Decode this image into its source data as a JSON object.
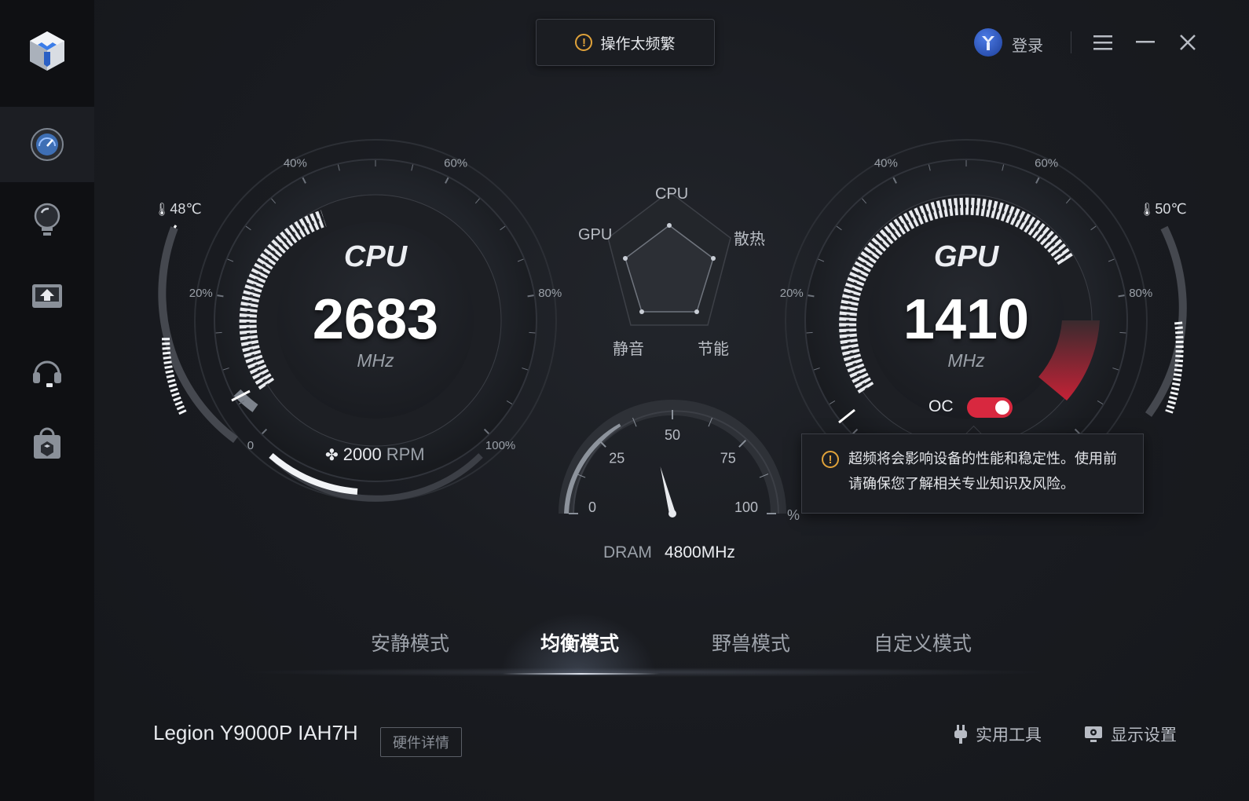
{
  "toast": {
    "text": "操作太频繁"
  },
  "header": {
    "login_label": "登录"
  },
  "cpu_gauge": {
    "title": "CPU",
    "value": "2683",
    "unit": "MHz",
    "temp": "48℃",
    "fan_value": "2000",
    "fan_unit": "RPM",
    "ticks": [
      "0",
      "20%",
      "40%",
      "60%",
      "80%",
      "100%"
    ],
    "load_fraction": 0.08
  },
  "gpu_gauge": {
    "title": "GPU",
    "value": "1410",
    "unit": "MHz",
    "temp": "50℃",
    "ticks": [
      "20%",
      "40%",
      "60%",
      "80%"
    ],
    "oc_label": "OC",
    "oc_enabled": true
  },
  "radar": {
    "labels": {
      "top": "CPU",
      "left": "GPU",
      "right": "散热",
      "bottom_left": "静音",
      "bottom_right": "节能"
    }
  },
  "dram_gauge": {
    "ticks": [
      "0",
      "25",
      "50",
      "75",
      "100"
    ],
    "unit": "%",
    "label": "DRAM",
    "value": "4800MHz",
    "needle_percent": 42
  },
  "tooltip": {
    "text": "超频将会影响设备的性能和稳定性。使用前请确保您了解相关专业知识及风险。"
  },
  "modes": [
    {
      "label": "安静模式",
      "active": false
    },
    {
      "label": "均衡模式",
      "active": true
    },
    {
      "label": "野兽模式",
      "active": false
    },
    {
      "label": "自定义模式",
      "active": false
    }
  ],
  "footer": {
    "device_name": "Legion Y9000P IAH7H",
    "hardware_details_label": "硬件详情",
    "tools_label": "实用工具",
    "display_settings_label": "显示设置"
  },
  "colors": {
    "accent_red": "#d8283f",
    "warning": "#e0a23a"
  }
}
